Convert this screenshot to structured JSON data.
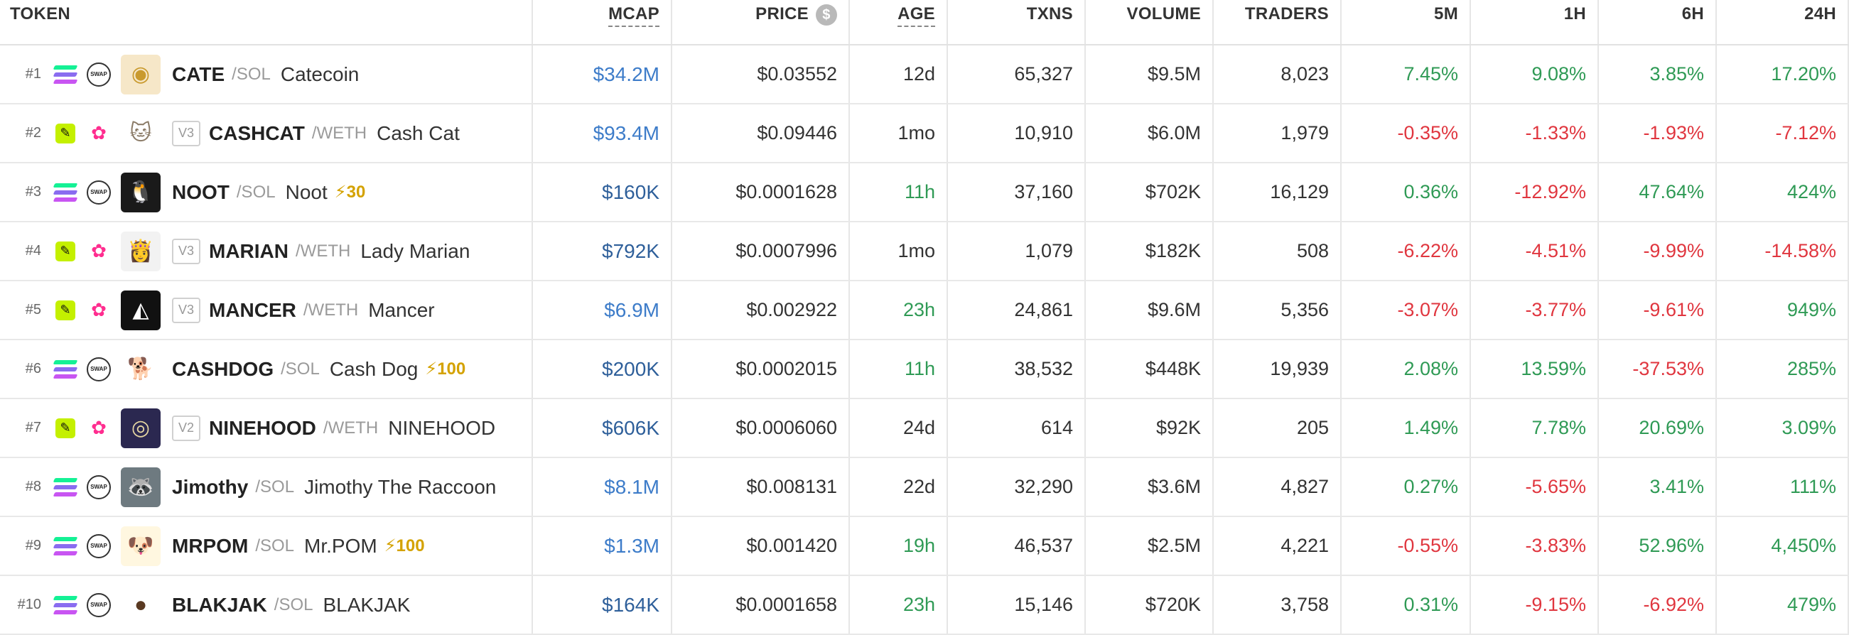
{
  "columns": {
    "token": "TOKEN",
    "mcap": "MCAP",
    "price": "PRICE",
    "age": "AGE",
    "txns": "TXNS",
    "volume": "VOLUME",
    "traders": "TRADERS",
    "m5": "5M",
    "h1": "1H",
    "h6": "6H",
    "h24": "24H"
  },
  "price_currency_icon": "$",
  "colors": {
    "positive": "#2f9a55",
    "negative": "#e0363f",
    "mcap": "#3d7cc9",
    "boost": "#d4a200"
  },
  "rows": [
    {
      "rank": "#1",
      "chain": "solana-icon",
      "dex": "raydium-swap-icon",
      "dex_label": "SWAP",
      "logo": "cate-logo",
      "version": "",
      "symbol": "CATE",
      "pair": "/SOL",
      "name": "Catecoin",
      "boost": "",
      "mcap": "$34.2M",
      "price": "$0.03552",
      "age": "12d",
      "age_color": "dark",
      "txns": "65,327",
      "volume": "$9.5M",
      "traders": "8,023",
      "m5": "7.45%",
      "h1": "9.08%",
      "h6": "3.85%",
      "h24": "17.20%"
    },
    {
      "rank": "#2",
      "chain": "base-icon",
      "dex": "uniswap-icon",
      "dex_label": "",
      "logo": "cashcat-logo",
      "version": "V3",
      "symbol": "CASHCAT",
      "pair": "/WETH",
      "name": "Cash Cat",
      "boost": "",
      "mcap": "$93.4M",
      "price": "$0.09446",
      "age": "1mo",
      "age_color": "dark",
      "txns": "10,910",
      "volume": "$6.0M",
      "traders": "1,979",
      "m5": "-0.35%",
      "h1": "-1.33%",
      "h6": "-1.93%",
      "h24": "-7.12%"
    },
    {
      "rank": "#3",
      "chain": "solana-icon",
      "dex": "raydium-swap-icon",
      "dex_label": "SWAP",
      "logo": "noot-logo",
      "version": "",
      "symbol": "NOOT",
      "pair": "/SOL",
      "name": "Noot",
      "boost": "⚡30",
      "mcap": "$160K",
      "price": "$0.0001628",
      "age": "11h",
      "age_color": "green",
      "txns": "37,160",
      "volume": "$702K",
      "traders": "16,129",
      "m5": "0.36%",
      "h1": "-12.92%",
      "h6": "47.64%",
      "h24": "424%"
    },
    {
      "rank": "#4",
      "chain": "base-icon",
      "dex": "uniswap-icon",
      "dex_label": "",
      "logo": "marian-logo",
      "version": "V3",
      "symbol": "MARIAN",
      "pair": "/WETH",
      "name": "Lady Marian",
      "boost": "",
      "mcap": "$792K",
      "price": "$0.0007996",
      "age": "1mo",
      "age_color": "dark",
      "txns": "1,079",
      "volume": "$182K",
      "traders": "508",
      "m5": "-6.22%",
      "h1": "-4.51%",
      "h6": "-9.99%",
      "h24": "-14.58%"
    },
    {
      "rank": "#5",
      "chain": "base-icon",
      "dex": "uniswap-icon",
      "dex_label": "",
      "logo": "mancer-logo",
      "version": "V3",
      "symbol": "MANCER",
      "pair": "/WETH",
      "name": "Mancer",
      "boost": "",
      "mcap": "$6.9M",
      "price": "$0.002922",
      "age": "23h",
      "age_color": "green",
      "txns": "24,861",
      "volume": "$9.6M",
      "traders": "5,356",
      "m5": "-3.07%",
      "h1": "-3.77%",
      "h6": "-9.61%",
      "h24": "949%"
    },
    {
      "rank": "#6",
      "chain": "solana-icon",
      "dex": "raydium-swap-icon",
      "dex_label": "SWAP",
      "logo": "cashdog-logo",
      "version": "",
      "symbol": "CASHDOG",
      "pair": "/SOL",
      "name": "Cash Dog",
      "boost": "⚡100",
      "mcap": "$200K",
      "price": "$0.0002015",
      "age": "11h",
      "age_color": "green",
      "txns": "38,532",
      "volume": "$448K",
      "traders": "19,939",
      "m5": "2.08%",
      "h1": "13.59%",
      "h6": "-37.53%",
      "h24": "285%"
    },
    {
      "rank": "#7",
      "chain": "base-icon",
      "dex": "uniswap-icon",
      "dex_label": "",
      "logo": "ninehood-logo",
      "version": "V2",
      "symbol": "NINEHOOD",
      "pair": "/WETH",
      "name": "NINEHOOD",
      "boost": "",
      "mcap": "$606K",
      "price": "$0.0006060",
      "age": "24d",
      "age_color": "dark",
      "txns": "614",
      "volume": "$92K",
      "traders": "205",
      "m5": "1.49%",
      "h1": "7.78%",
      "h6": "20.69%",
      "h24": "3.09%"
    },
    {
      "rank": "#8",
      "chain": "solana-icon",
      "dex": "raydium-swap-icon",
      "dex_label": "SWAP",
      "logo": "jimothy-logo",
      "version": "",
      "symbol": "Jimothy",
      "pair": "/SOL",
      "name": "Jimothy The Raccoon",
      "boost": "",
      "mcap": "$8.1M",
      "price": "$0.008131",
      "age": "22d",
      "age_color": "dark",
      "txns": "32,290",
      "volume": "$3.6M",
      "traders": "4,827",
      "m5": "0.27%",
      "h1": "-5.65%",
      "h6": "3.41%",
      "h24": "111%"
    },
    {
      "rank": "#9",
      "chain": "solana-icon",
      "dex": "raydium-swap-icon",
      "dex_label": "SWAP",
      "logo": "mrpom-logo",
      "version": "",
      "symbol": "MRPOM",
      "pair": "/SOL",
      "name": "Mr.POM",
      "boost": "⚡100",
      "mcap": "$1.3M",
      "price": "$0.001420",
      "age": "19h",
      "age_color": "green",
      "txns": "46,537",
      "volume": "$2.5M",
      "traders": "4,221",
      "m5": "-0.55%",
      "h1": "-3.83%",
      "h6": "52.96%",
      "h24": "4,450%"
    },
    {
      "rank": "#10",
      "chain": "solana-icon",
      "dex": "raydium-swap-icon",
      "dex_label": "SWAP",
      "logo": "blakjak-logo",
      "version": "",
      "symbol": "BLAKJAK",
      "pair": "/SOL",
      "name": "BLAKJAK",
      "boost": "",
      "mcap": "$164K",
      "price": "$0.0001658",
      "age": "23h",
      "age_color": "green",
      "txns": "15,146",
      "volume": "$720K",
      "traders": "3,758",
      "m5": "0.31%",
      "h1": "-9.15%",
      "h6": "-6.92%",
      "h24": "479%"
    }
  ]
}
